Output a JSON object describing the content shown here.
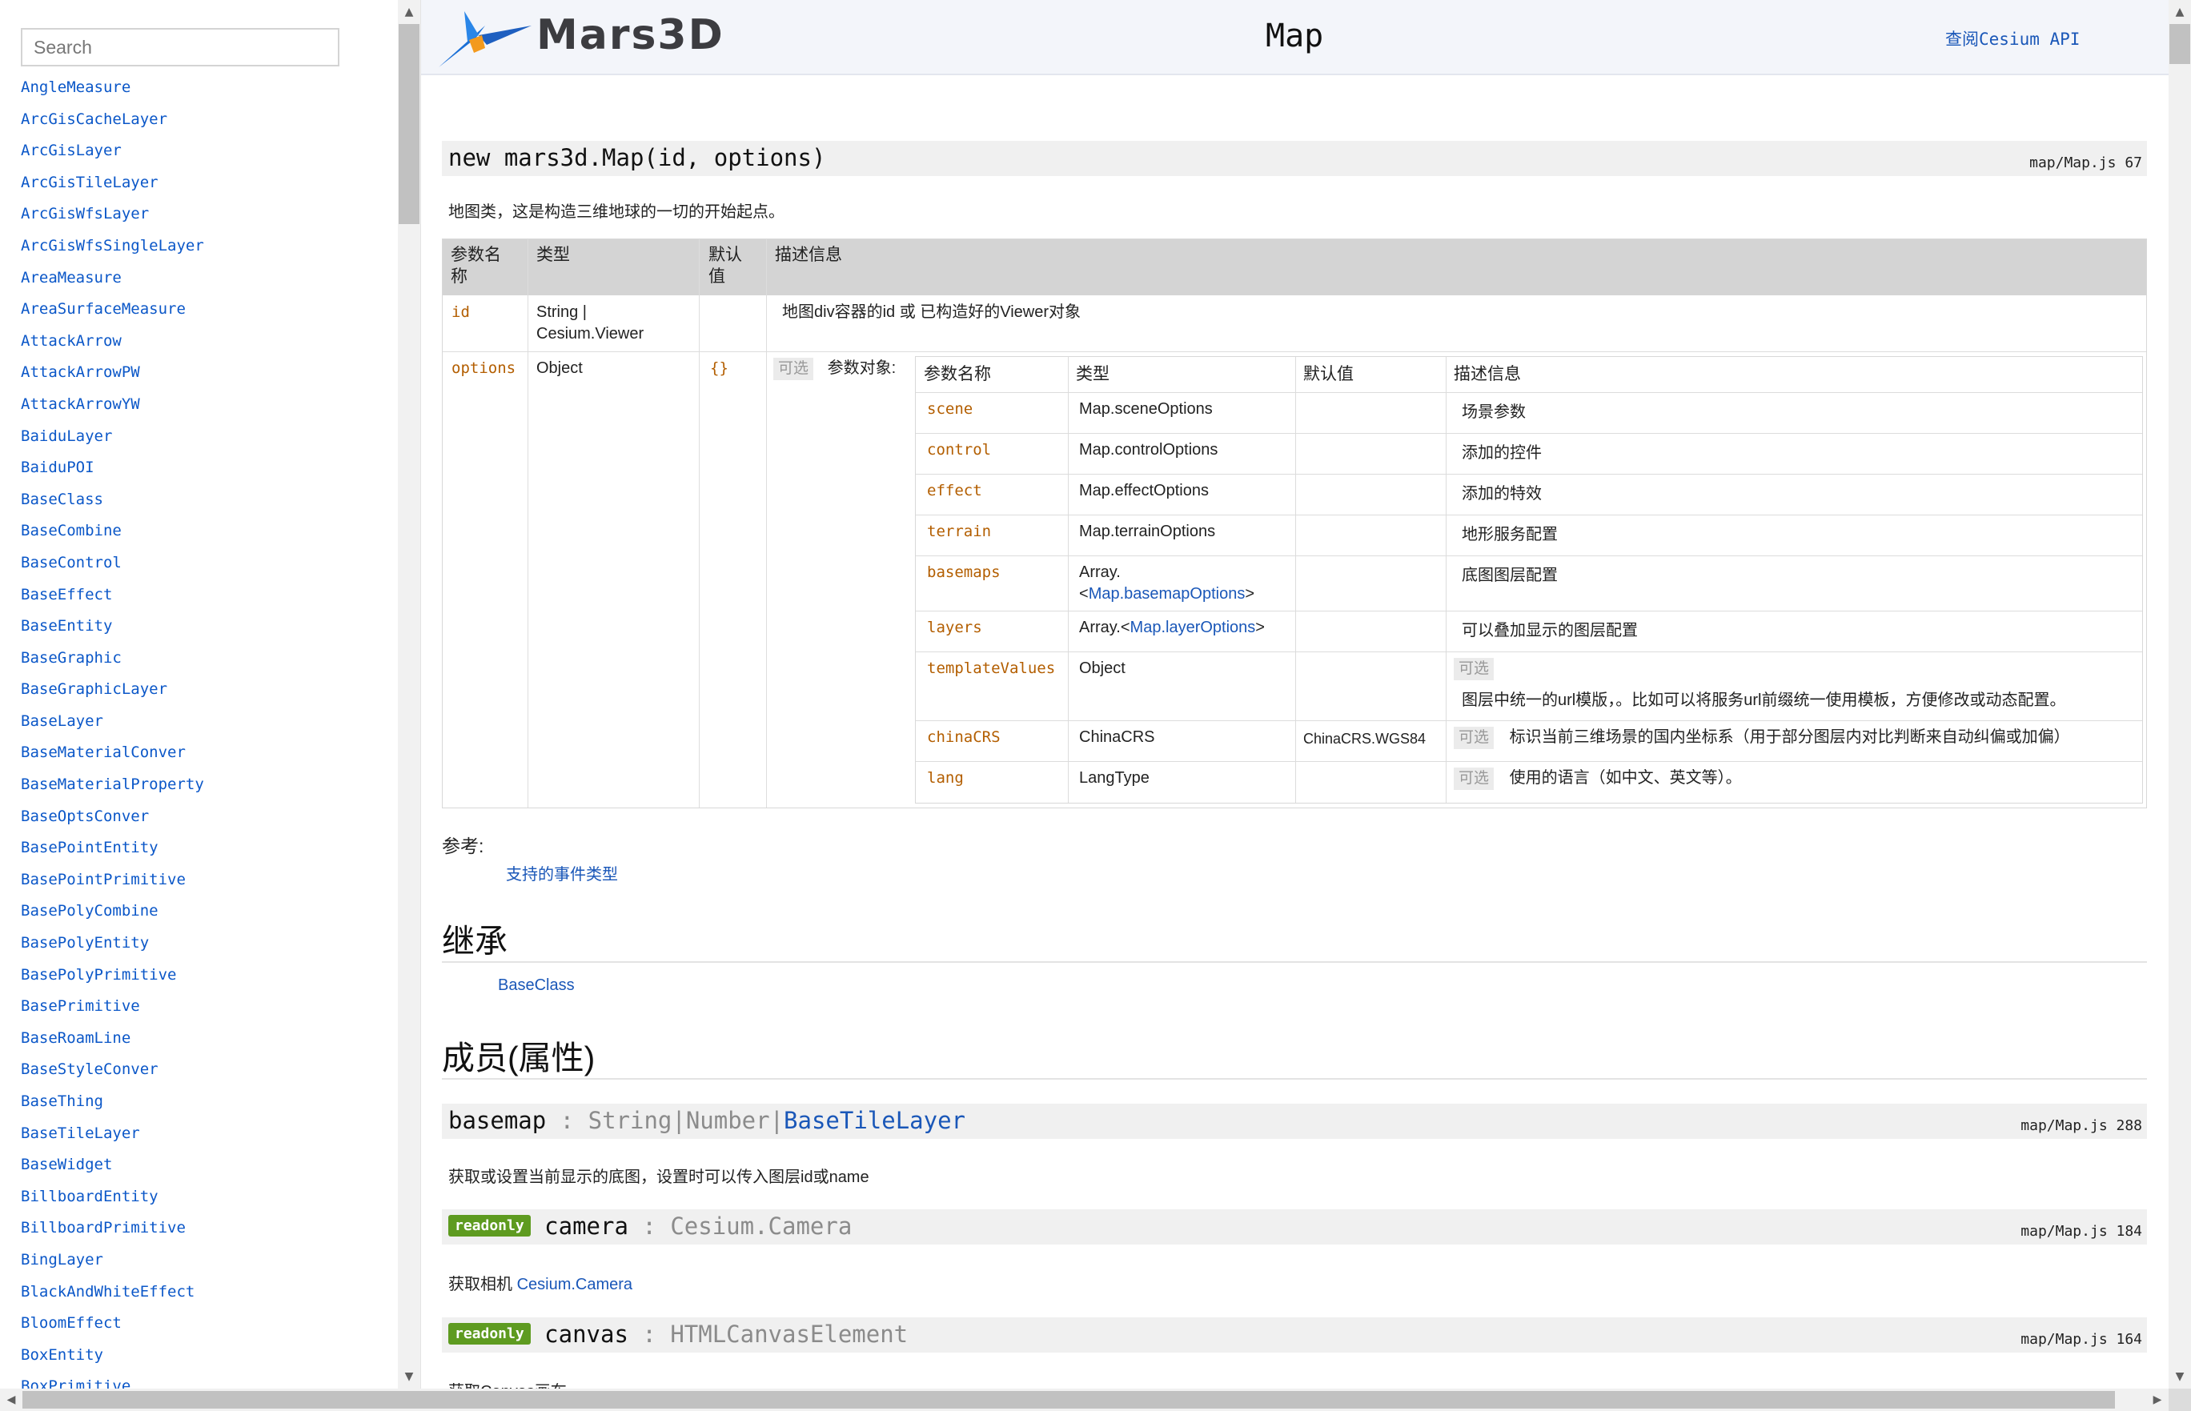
{
  "sidebar": {
    "search_placeholder": "Search",
    "items": [
      "AngleMeasure",
      "ArcGisCacheLayer",
      "ArcGisLayer",
      "ArcGisTileLayer",
      "ArcGisWfsLayer",
      "ArcGisWfsSingleLayer",
      "AreaMeasure",
      "AreaSurfaceMeasure",
      "AttackArrow",
      "AttackArrowPW",
      "AttackArrowYW",
      "BaiduLayer",
      "BaiduPOI",
      "BaseClass",
      "BaseCombine",
      "BaseControl",
      "BaseEffect",
      "BaseEntity",
      "BaseGraphic",
      "BaseGraphicLayer",
      "BaseLayer",
      "BaseMaterialConver",
      "BaseMaterialProperty",
      "BaseOptsConver",
      "BasePointEntity",
      "BasePointPrimitive",
      "BasePolyCombine",
      "BasePolyEntity",
      "BasePolyPrimitive",
      "BasePrimitive",
      "BaseRoamLine",
      "BaseStyleConver",
      "BaseThing",
      "BaseTileLayer",
      "BaseWidget",
      "BillboardEntity",
      "BillboardPrimitive",
      "BingLayer",
      "BlackAndWhiteEffect",
      "BloomEffect",
      "BoxEntity",
      "BoxPrimitive"
    ]
  },
  "header": {
    "logo_text": "Mars3D",
    "title": "Map",
    "api_link": "查阅Cesium API"
  },
  "constructor": {
    "signature": "new mars3d.Map(id, options)",
    "source": "map/Map.js 67",
    "description": "地图类，这是构造三维地球的一切的开始起点。"
  },
  "params": {
    "headers": {
      "name_l1": "参数名",
      "name_l2": "称",
      "type": "类型",
      "default_l1": "默认",
      "default_l2": "值",
      "desc": "描述信息"
    },
    "id_row": {
      "name": "id",
      "type_l1": "String |",
      "type_l2": "Cesium.Viewer",
      "desc": "地图div容器的id 或 已构造好的Viewer对象"
    },
    "options_row": {
      "name": "options",
      "type": "Object",
      "default": "{}",
      "optional": "可选",
      "desc_label": "参数对象:"
    }
  },
  "nested": {
    "headers": {
      "name": "参数名称",
      "type": "类型",
      "default": "默认值",
      "desc": "描述信息"
    },
    "rows": [
      {
        "name": "scene",
        "type_link": "Map.sceneOptions",
        "desc": "场景参数"
      },
      {
        "name": "control",
        "type_link": "Map.controlOptions",
        "desc": "添加的控件"
      },
      {
        "name": "effect",
        "type_link": "Map.effectOptions",
        "desc": "添加的特效"
      },
      {
        "name": "terrain",
        "type_link": "Map.terrainOptions",
        "desc": "地形服务配置"
      },
      {
        "name": "basemaps",
        "type_prefix": "Array.",
        "type_link_l2": "Map.basemapOptions",
        "desc": "底图图层配置"
      },
      {
        "name": "layers",
        "type_prefix": "Array.<",
        "type_link": "Map.layerOptions",
        "type_suffix": ">",
        "desc": "可以叠加显示的图层配置"
      },
      {
        "name": "templateValues",
        "type": "Object",
        "optional": "可选",
        "desc": "图层中统一的url模版，。比如可以将服务url前缀统一使用模板，方便修改或动态配置。"
      },
      {
        "name": "chinaCRS",
        "type_link": "ChinaCRS",
        "default": "ChinaCRS.WGS84",
        "optional": "可选",
        "desc": "标识当前三维场景的国内坐标系（用于部分图层内对比判断来自动纠偏或加偏）"
      },
      {
        "name": "lang",
        "type_link": "LangType",
        "optional": "可选",
        "desc": "使用的语言（如中文、英文等）。"
      }
    ]
  },
  "see_also": {
    "label": "参考:",
    "link": "支持的事件类型"
  },
  "inheritance": {
    "title": "继承",
    "link": "BaseClass"
  },
  "members": {
    "title": "成员(属性)",
    "items": [
      {
        "name": "basemap",
        "sep": " : ",
        "type_plain": "String|Number|",
        "type_link": "BaseTileLayer",
        "source": "map/Map.js 288",
        "desc": "获取或设置当前显示的底图，设置时可以传入图层id或name"
      },
      {
        "badge": "readonly",
        "name": "camera",
        "sep": " : ",
        "type_plain": "Cesium.Camera",
        "source": "map/Map.js 184",
        "desc_prefix": "获取相机 ",
        "desc_link": "Cesium.Camera"
      },
      {
        "badge": "readonly",
        "name": "canvas",
        "sep": " : ",
        "type_plain": "HTMLCanvasElement",
        "source": "map/Map.js 164",
        "desc": "获取Canvas画布"
      }
    ]
  },
  "colors": {
    "link": "#1a57b8",
    "param_name": "#b35e00",
    "badge": "#5e9b20",
    "header_bg": "#f3f5fa"
  }
}
